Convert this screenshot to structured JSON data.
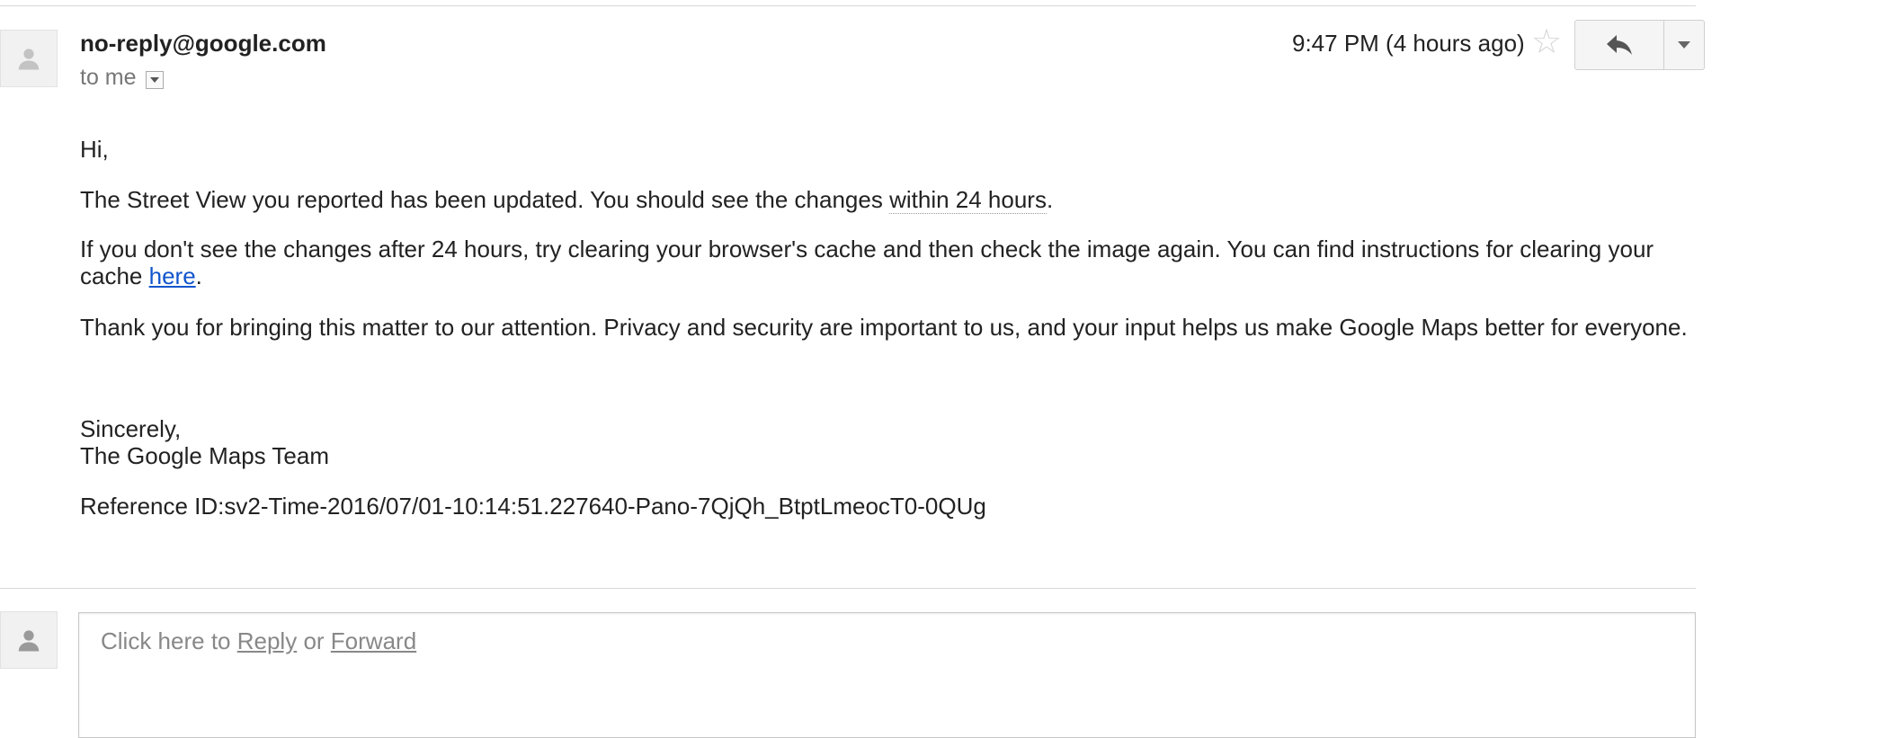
{
  "message": {
    "sender": "no-reply@google.com",
    "recipient_line": "to me",
    "timestamp": "9:47 PM (4 hours ago)",
    "body": {
      "greeting": "Hi,",
      "p1_before": "The Street View you reported has been updated. You should see the changes ",
      "p1_emph": "within 24 hours",
      "p1_after": ".",
      "p2_before": "If you don't see the changes after 24 hours, try clearing your browser's cache and then check the image again. You can find instructions for clearing your cache ",
      "p2_link": "here",
      "p2_after": ".",
      "p3": "Thank you for bringing this matter to our attention. Privacy and security are important to us, and your input helps us make Google Maps better for everyone.",
      "sign_off": "Sincerely,",
      "signature": "The Google Maps Team",
      "reference": "Reference ID:sv2-Time-2016/07/01-10:14:51.227640-Pano-7QjQh_BtptLmeocT0-0QUg"
    }
  },
  "reply_prompt": {
    "prefix": "Click here to ",
    "reply": "Reply",
    "middle": " or ",
    "forward": "Forward"
  },
  "icons": {
    "avatar": "person-icon",
    "star": "star-icon",
    "reply": "reply-arrow-icon",
    "more": "dropdown-arrow-icon",
    "details": "show-details-icon"
  },
  "colors": {
    "link": "#1155cc",
    "muted_text": "#777777",
    "star": "#d6d6d6"
  }
}
